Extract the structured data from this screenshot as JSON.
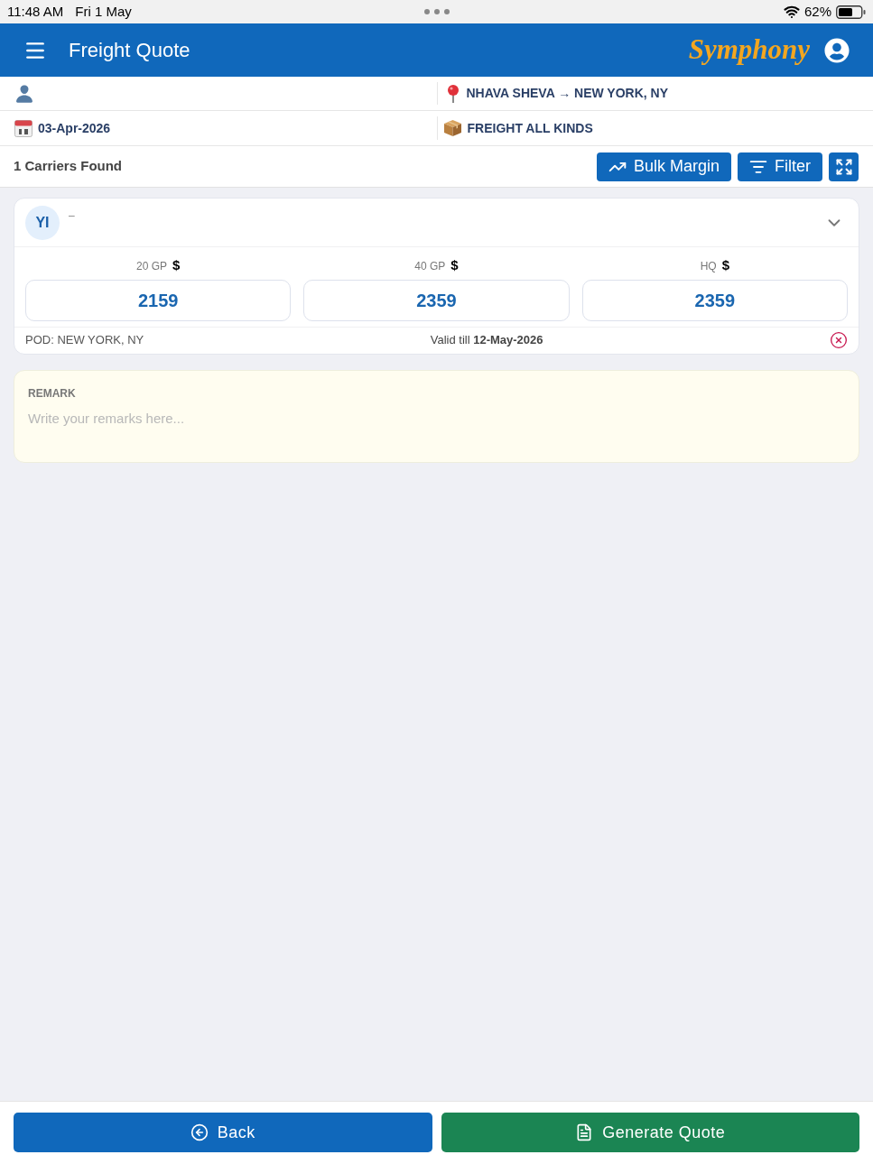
{
  "status_bar": {
    "time": "11:48 AM",
    "date": "Fri 1 May",
    "battery": "62%"
  },
  "header": {
    "title": "Freight Quote",
    "logo": "Symphony"
  },
  "info": {
    "route": "NHAVA SHEVA → NEW YORK, NY",
    "date": "03-Apr-2026",
    "commodity": "FREIGHT ALL KINDS"
  },
  "toolbar": {
    "count": "1 Carriers Found",
    "buttons": [
      {
        "kind": "bulk_margin",
        "label": "Bulk Margin"
      },
      {
        "kind": "filter",
        "label": "Filter"
      },
      {
        "kind": "expand"
      }
    ]
  },
  "carrier": {
    "initials": "YI",
    "name": "–",
    "rates": [
      {
        "label": "20 GP",
        "currency": "$",
        "value": "2159"
      },
      {
        "label": "40 GP",
        "currency": "$",
        "value": "2359"
      },
      {
        "label": "HQ",
        "currency": "$",
        "value": "2359"
      }
    ],
    "pod": "POD: NEW YORK, NY",
    "valid": "Valid till **12-May-2026**"
  },
  "remark": {
    "label": "REMARK",
    "placeholder": "Write your remarks here..."
  },
  "footer": {
    "buttons": [
      {
        "kind": "back",
        "label": "Back"
      },
      {
        "kind": "generate",
        "label": "Generate Quote"
      }
    ]
  }
}
